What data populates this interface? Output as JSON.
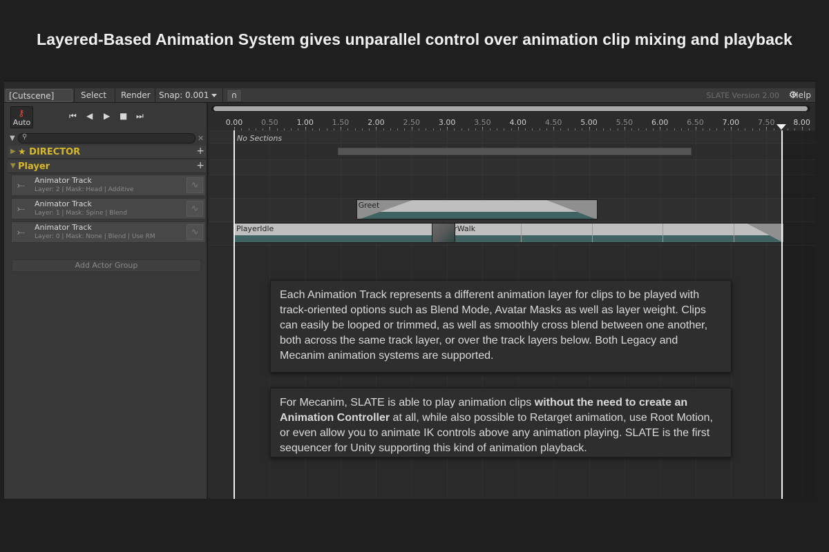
{
  "headline": "Layered-Based Animation System gives unparallel control over animation clip mixing and playback",
  "toolbar": {
    "cutscene_dropdown": "[Cutscene]",
    "select_label": "Select",
    "render_label": "Render",
    "snap_label": "Snap: 0.001",
    "magnet_icon": "magnet-icon",
    "version": "SLATE Version 2.00",
    "help_label": "Help"
  },
  "auto_key": {
    "label": "Auto",
    "icon": "key-icon"
  },
  "transport": {
    "first": "⏮",
    "prev": "◀",
    "play": "▶",
    "stop": "■",
    "last": "⏭"
  },
  "search": {
    "placeholder": ""
  },
  "groups": [
    {
      "label": "★ DIRECTOR"
    },
    {
      "label": "Player"
    }
  ],
  "tracks": [
    {
      "name": "Animator Track",
      "info": "Layer: 2 | Mask: Head | Additive"
    },
    {
      "name": "Animator Track",
      "info": "Layer: 1 | Mask: Spine | Blend"
    },
    {
      "name": "Animator Track",
      "info": "Layer: 0 | Mask: None | Blend | Use RM"
    }
  ],
  "add_actor_group": "Add Actor Group",
  "ruler": {
    "labels": [
      "0.00",
      "0.50",
      "1.00",
      "1.50",
      "2.00",
      "2.50",
      "3.00",
      "3.50",
      "4.00",
      "4.50",
      "5.00",
      "5.50",
      "6.00",
      "6.50",
      "7.00",
      "7.50",
      "8.00"
    ]
  },
  "timeline": {
    "no_sections": "No Sections",
    "end_time": 7.75
  },
  "clips": [
    {
      "name": "Greet",
      "track": 1,
      "start": 1.72,
      "end": 5.12
    },
    {
      "name": "PlayerIdle",
      "track": 2,
      "start": 0.0,
      "end": 3.12
    },
    {
      "name": "PlayerWalk",
      "track": 2,
      "start": 2.78,
      "end": 7.75
    }
  ],
  "notes": {
    "note1": "Each Animation Track represents a different animation layer for clips to be played with track-oriented options such as Blend Mode, Avatar Masks as well as layer weight. Clips can easily be looped or trimmed, as well as smoothly cross blend between one another, both across the same track layer, or over the track layers below. Both Legacy and Mecanim animation systems are supported.",
    "note2_pre": "For Mecanim, SLATE is able to play animation clips ",
    "note2_bold": "without the need to create an Animation Controller",
    "note2_post": " at all, while also possible to Retarget animation, use Root Motion, or even allow you to animate IK controls above any animation playing. SLATE is the first sequencer for Unity supporting this kind of animation playback."
  }
}
